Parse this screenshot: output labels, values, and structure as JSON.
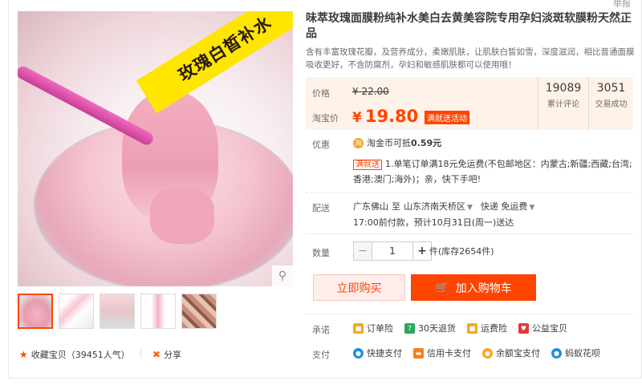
{
  "top_link": "举报",
  "gallery": {
    "banner_text": "玫瑰白皙补水",
    "zoom_icon": "magnifier-icon",
    "favorite_label": "收藏宝贝",
    "favorite_count": "（39451人气）",
    "share_label": "分享"
  },
  "product": {
    "title": "味萃玫瑰面膜粉纯补水美白去黄美容院专用孕妇淡斑软膜粉天然正品",
    "subtitle": "含有丰富玫瑰花瓣，及营养成分，柔嫩肌肤，让肌肤白皙如雪，深度滋润，相比普通面膜吸收更好，不含防腐剂，孕妇和敏感肌肤都可以使用哦！"
  },
  "price": {
    "price_label": "价格",
    "old_price": "¥ 22.00",
    "taobao_label": "淘宝价",
    "currency": "¥",
    "current_price": "19.80",
    "promo_badge": "满就送活动",
    "stats": [
      {
        "value": "19089",
        "label": "累计评论"
      },
      {
        "value": "3051",
        "label": "交易成功"
      }
    ]
  },
  "promotions": {
    "label": "优惠",
    "coin_text": "淘金币可抵",
    "coin_amount": "0.59元",
    "manjiu_tag": "满就送",
    "manjiu_text": "1.单笔订单满18元免运费(不包邮地区：内蒙古;新疆;西藏;台湾;香港;澳门;海外)；亲，快下手吧!"
  },
  "shipping": {
    "label": "配送",
    "from": "广东佛山",
    "to_word": "至",
    "to": "山东济南天桥区",
    "method": "快递 免运费",
    "eta": "17:00前付款，预计10月31日(周一)送达"
  },
  "quantity": {
    "label": "数量",
    "value": "1",
    "stock": "件(库存2654件)"
  },
  "actions": {
    "buy_now": "立即购买",
    "add_to_cart": "加入购物车"
  },
  "promise": {
    "label": "承诺",
    "items": [
      {
        "icon": "order-insurance-icon",
        "text": "订单险",
        "color": "#f5a623"
      },
      {
        "icon": "return-30-icon",
        "text": "30天退货",
        "color": "#2aa85a"
      },
      {
        "icon": "freight-insurance-icon",
        "text": "运费险",
        "color": "#f5a623"
      },
      {
        "icon": "charity-icon",
        "text": "公益宝贝",
        "color": "#e4393c"
      }
    ]
  },
  "payment": {
    "label": "支付",
    "items": [
      {
        "icon": "quick-pay-icon",
        "text": "快捷支付",
        "color": "#1e90d6"
      },
      {
        "icon": "credit-card-icon",
        "text": "信用卡支付",
        "color": "#f57f17"
      },
      {
        "icon": "yuebao-icon",
        "text": "余额宝支付",
        "color": "#f5a623"
      },
      {
        "icon": "huabei-icon",
        "text": "蚂蚁花呗",
        "color": "#1e90d6"
      }
    ]
  },
  "colors": {
    "accent": "#ff4400",
    "price_bg": "#fff2e8"
  }
}
